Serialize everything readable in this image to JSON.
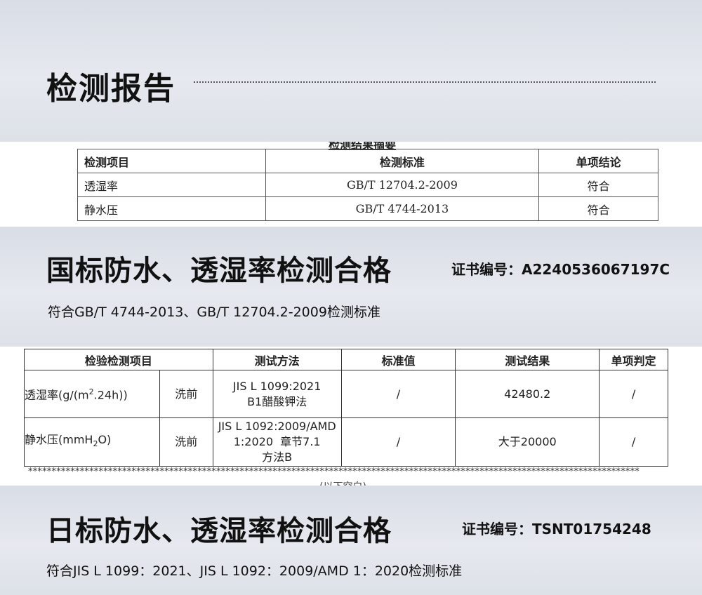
{
  "header": {
    "title": "检测报告"
  },
  "table1": {
    "cut_caption": "检测结果摘要",
    "headers": [
      "检测项目",
      "检测标准",
      "单项结论"
    ],
    "rows": [
      [
        "透湿率",
        "GB/T 12704.2-2009",
        "符合"
      ],
      [
        "静水压",
        "GB/T 4744-2013",
        "符合"
      ]
    ]
  },
  "section_national": {
    "title": "国标防水、透湿率检测合格",
    "cert_label": "证书编号：",
    "cert_number": "A2240536067197C",
    "compliance": "符合GB/T 4744-2013、GB/T 12704.2-2009检测标准"
  },
  "table2": {
    "headers": {
      "item": "检验检测项目",
      "method": "测试方法",
      "standard": "标准值",
      "result": "测试结果",
      "judgement": "单项判定"
    },
    "rows": [
      {
        "item_prefix": "透湿率(g/(m",
        "item_sup": "2",
        "item_suffix": ".24h))",
        "condition": "洗前",
        "method_lines": [
          "JIS L 1099:2021",
          "B1醋酸钾法"
        ],
        "standard": "/",
        "result": "42480.2",
        "judgement": "/"
      },
      {
        "item_prefix": "静水压(mmH",
        "item_sub": "2",
        "item_suffix": "O)",
        "condition": "洗前",
        "method_lines": [
          "JIS L 1092:2009/AMD",
          "1:2020  章节7.1",
          "方法B"
        ],
        "standard": "/",
        "result": "大于20000",
        "judgement": "/"
      }
    ],
    "stars": "**********************************************************************************************************************************",
    "cut_bottom": "(以下空白)"
  },
  "section_japan": {
    "title": "日标防水、透湿率检测合格",
    "cert_label": "证书编号：",
    "cert_number": "TSNT01754248",
    "compliance": "符合JIS L 1099：2021、JIS L 1092：2009/AMD 1：2020检测标准"
  }
}
